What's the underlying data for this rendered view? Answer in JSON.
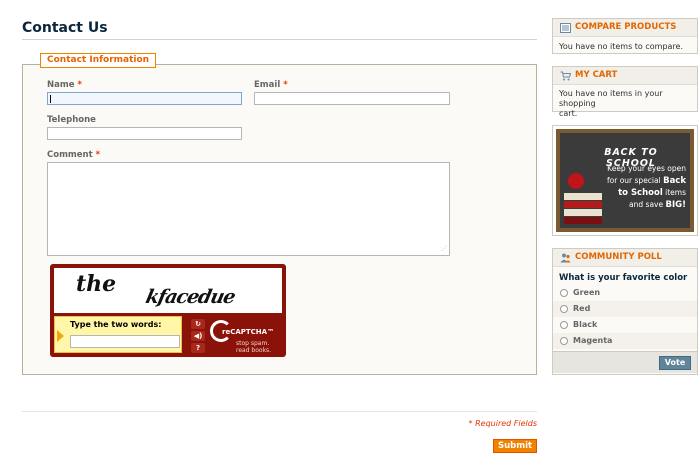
{
  "page": {
    "title": "Contact Us"
  },
  "form": {
    "legend": "Contact Information",
    "name_label": "Name",
    "email_label": "Email",
    "telephone_label": "Telephone",
    "comment_label": "Comment",
    "required_mark": "*",
    "name_value": "",
    "email_value": "",
    "telephone_value": "",
    "comment_value": "",
    "required_note": "* Required Fields",
    "submit_label": "Submit"
  },
  "captcha": {
    "word1": "the",
    "word2": "kfacedue",
    "prompt": "Type the two words:",
    "input_value": "",
    "logo_name": "reCAPTCHA™",
    "logo_tagline_1": "stop spam.",
    "logo_tagline_2": "read books.",
    "refresh_icon": "↻",
    "audio_icon": "◀)",
    "help_icon": "?"
  },
  "sidebar": {
    "compare": {
      "title": "COMPARE PRODUCTS",
      "text": "You have no items to compare."
    },
    "cart": {
      "title": "MY CART",
      "text_line1": "You have no items in your shopping",
      "text_line2": "cart."
    },
    "promo": {
      "heading": "BACK TO SCHOOL",
      "line1": "Keep your eyes open",
      "line2": "for our special",
      "line2_bold": "Back",
      "line3_bold": "to School",
      "line3": "items",
      "line4": "and save",
      "line4_bold": "BIG!"
    },
    "poll": {
      "title": "COMMUNITY POLL",
      "question": "What is your favorite color",
      "options": [
        "Green",
        "Red",
        "Black",
        "Magenta"
      ],
      "vote_label": "Vote"
    }
  },
  "colors": {
    "accent_orange": "#f18200",
    "title_blue": "#0a263c",
    "required_red": "#eb340a",
    "captcha_red": "#8b1209",
    "vote_blue": "#618499"
  }
}
